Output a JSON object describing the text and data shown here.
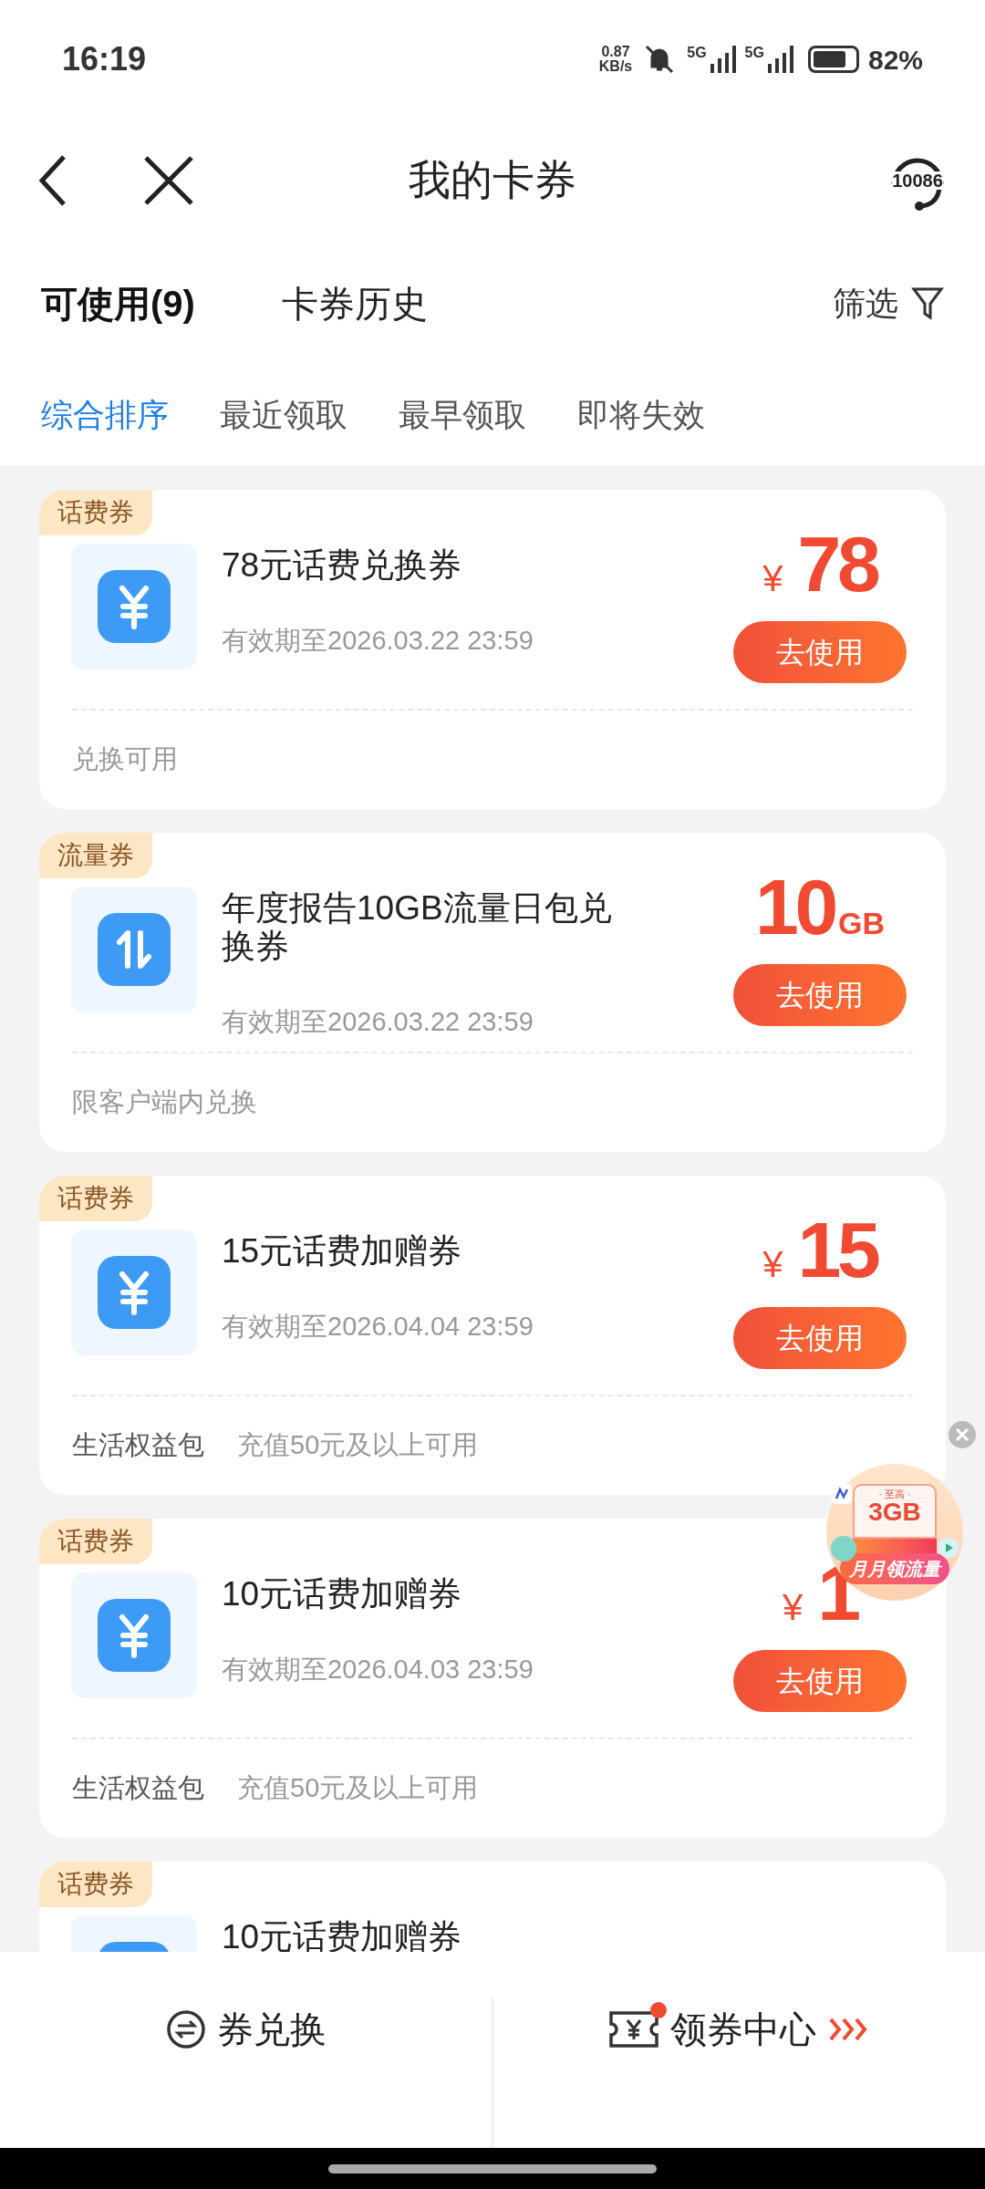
{
  "status_bar": {
    "time": "16:19",
    "net_speed": "0.87",
    "net_unit": "KB/s",
    "signal_1": "5G",
    "signal_2": "5G",
    "battery": "82%"
  },
  "header": {
    "title": "我的卡券",
    "service_label": "10086"
  },
  "tabs": [
    {
      "label": "可使用(9)",
      "selected": true
    },
    {
      "label": "卡券历史",
      "selected": false
    }
  ],
  "filter": {
    "label": "筛选"
  },
  "sort_options": [
    {
      "label": "综合排序",
      "selected": true
    },
    {
      "label": "最近领取",
      "selected": false
    },
    {
      "label": "最早领取",
      "selected": false
    },
    {
      "label": "即将失效",
      "selected": false
    }
  ],
  "coupons": [
    {
      "tag": "话费券",
      "kind": "money",
      "title": "78元话费兑换券",
      "expiry": "有效期至2026.03.22 23:59",
      "prefix": "¥",
      "amount": "78",
      "button": "去使用",
      "condition": "兑换可用"
    },
    {
      "tag": "流量券",
      "kind": "data",
      "title": "年度报告10GB流量日包兑换券",
      "expiry": "有效期至2026.03.22 23:59",
      "amount": "10",
      "suffix": "GB",
      "button": "去使用",
      "condition": "限客户端内兑换"
    },
    {
      "tag": "话费券",
      "kind": "money",
      "title": "15元话费加赠券",
      "expiry": "有效期至2026.04.04 23:59",
      "prefix": "¥",
      "amount": "15",
      "button": "去使用",
      "package": "生活权益包",
      "condition": "充值50元及以上可用"
    },
    {
      "tag": "话费券",
      "kind": "money",
      "title": "10元话费加赠券",
      "expiry": "有效期至2026.04.03 23:59",
      "prefix": "¥",
      "amount": "1",
      "button": "去使用",
      "package": "生活权益包",
      "condition": "充值50元及以上可用"
    },
    {
      "tag": "话费券",
      "kind": "money",
      "title": "10元话费加赠券"
    }
  ],
  "promo": {
    "top": "· 至高 ·",
    "amount": "3GB",
    "label": "月月领流量"
  },
  "bottom_bar": [
    {
      "kind": "exchange",
      "label": "券兑换"
    },
    {
      "kind": "center",
      "label": "领券中心",
      "badge": true
    }
  ]
}
